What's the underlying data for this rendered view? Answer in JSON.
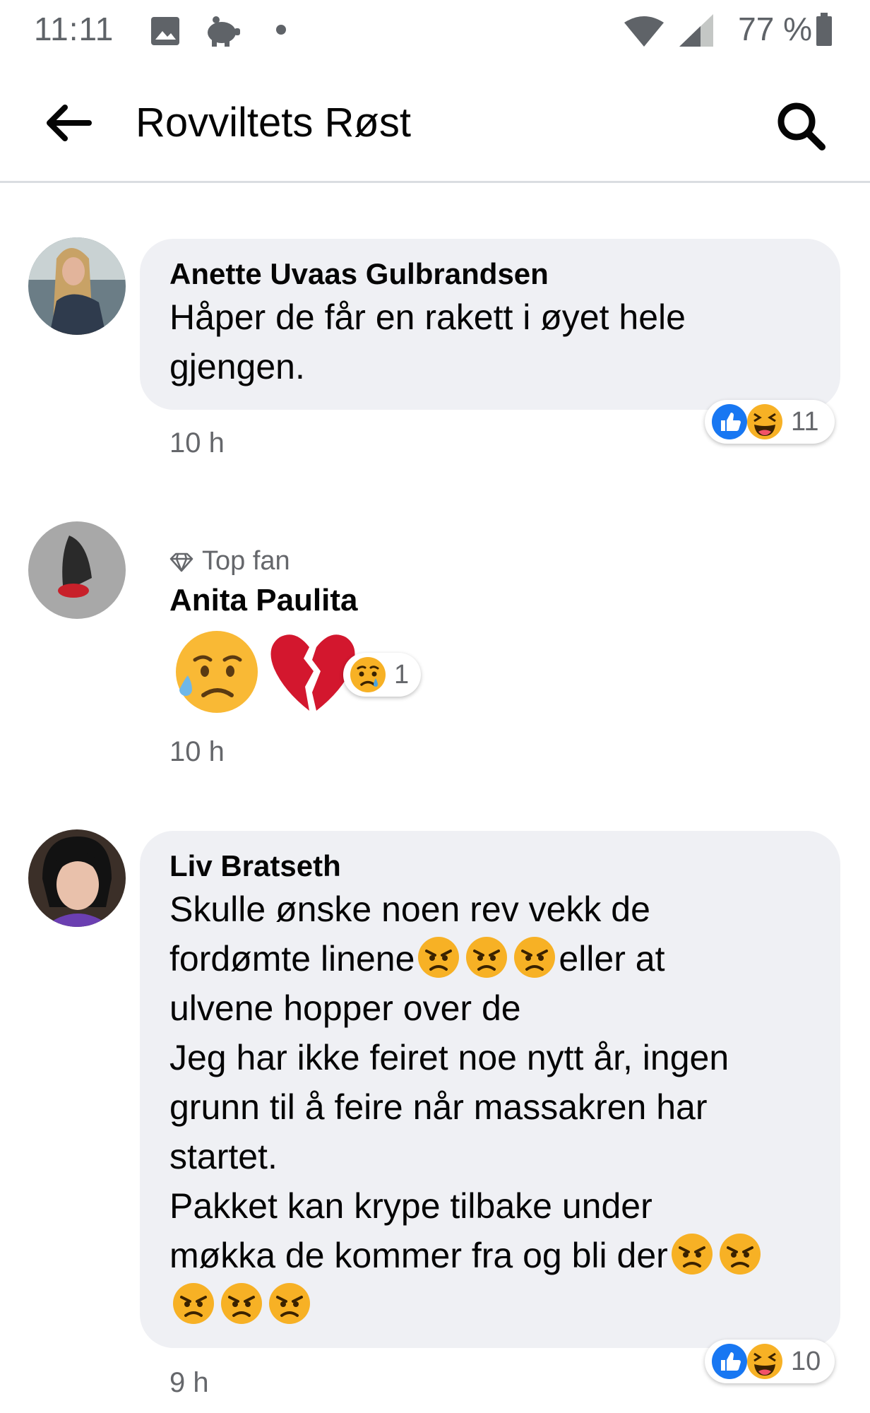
{
  "status_bar": {
    "time": "11:11",
    "battery": "77 %"
  },
  "header": {
    "title": "Rovviltets Røst"
  },
  "comments": [
    {
      "author": "Anette Uvaas Gulbrandsen",
      "text": "Håper de får en rakett i øyet hele\ngjengen.",
      "time": "10 h",
      "reaction_count": "11"
    },
    {
      "badge": "Top fan",
      "author": "Anita Paulita",
      "time": "10 h",
      "reaction_count": "1"
    },
    {
      "author": "Liv Bratseth",
      "text_1": "Skulle ønske noen rev vekk de",
      "text_2a": "fordømte linene",
      "text_2b": "eller at",
      "text_3": "ulvene hopper over de\nJeg har ikke feiret noe nytt år, ingen\ngrunn til å feire når massakren har\nstartet.\nPakket kan krype tilbake under",
      "text_4": "møkka de kommer fra og bli der",
      "time": "9 h",
      "reaction_count": "10"
    }
  ],
  "colors": {
    "like_blue": "#1877f2",
    "bubble_bg": "#eff0f4",
    "meta_gray": "#65676b"
  }
}
